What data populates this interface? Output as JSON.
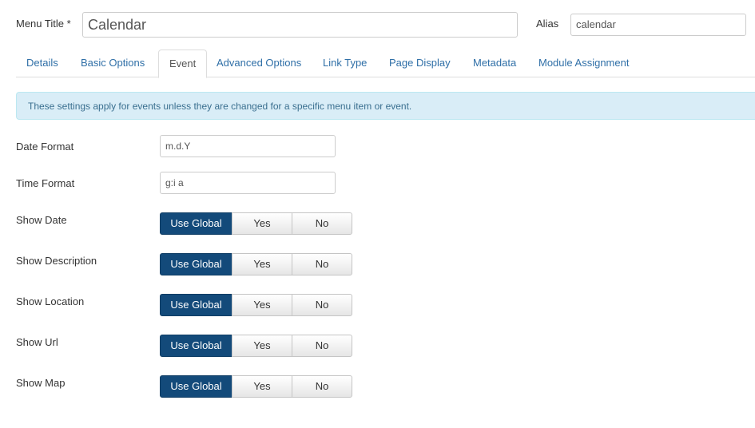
{
  "header": {
    "menu_title_label": "Menu Title *",
    "menu_title_value": "Calendar",
    "alias_label": "Alias",
    "alias_value": "calendar"
  },
  "tabs": [
    {
      "label": "Details",
      "active": false
    },
    {
      "label": "Basic Options",
      "active": false
    },
    {
      "label": "Event",
      "active": true
    },
    {
      "label": "Advanced Options",
      "active": false
    },
    {
      "label": "Link Type",
      "active": false
    },
    {
      "label": "Page Display",
      "active": false
    },
    {
      "label": "Metadata",
      "active": false
    },
    {
      "label": "Module Assignment",
      "active": false
    }
  ],
  "alert": {
    "text": "These settings apply for events unless they are changed for a specific menu item or event."
  },
  "text_fields": [
    {
      "label": "Date Format",
      "value": "m.d.Y"
    },
    {
      "label": "Time Format",
      "value": "g:i a"
    }
  ],
  "toggle_options": [
    "Use Global",
    "Yes",
    "No"
  ],
  "toggles": [
    {
      "label": "Show Date",
      "selected": "Use Global"
    },
    {
      "label": "Show Description",
      "selected": "Use Global"
    },
    {
      "label": "Show Location",
      "selected": "Use Global"
    },
    {
      "label": "Show Url",
      "selected": "Use Global"
    },
    {
      "label": "Show Map",
      "selected": "Use Global"
    }
  ],
  "colors": {
    "primary": "#134a7a",
    "link": "#2f6fa7",
    "alert_bg": "#d9edf7"
  }
}
